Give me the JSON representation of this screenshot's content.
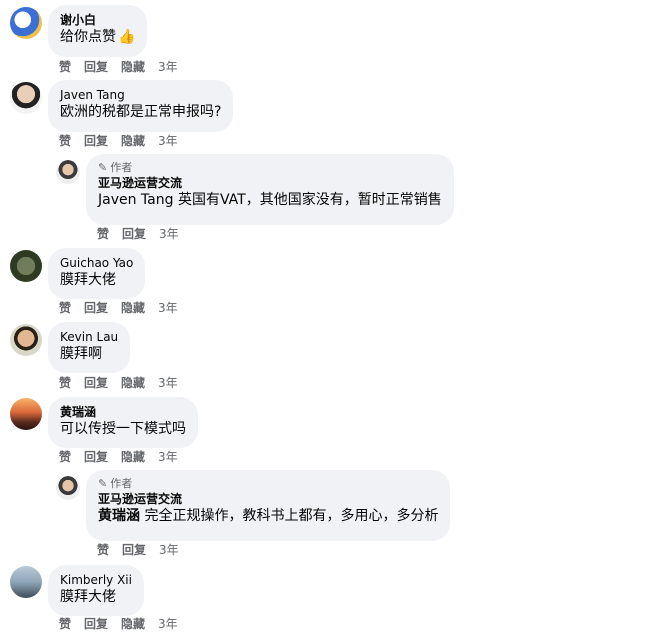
{
  "actions": {
    "like": "赞",
    "reply": "回复",
    "hide": "隐藏"
  },
  "comments": [
    {
      "name": "谢小白",
      "text": "给你点赞",
      "emoji": "👍",
      "time": "3年"
    },
    {
      "name": "Javen Tang",
      "text": "欧洲的税都是正常申报吗?",
      "time": "3年",
      "reply": {
        "tag": "作者",
        "name": "亚马逊运营交流",
        "mention": "Javen Tang",
        "text": " 英国有VAT，其他国家没有，暂时正常销售",
        "time": "3年"
      }
    },
    {
      "name": "Guichao Yao",
      "text": "膜拜大佬",
      "time": "3年"
    },
    {
      "name": "Kevin Lau",
      "text": "膜拜啊",
      "time": "3年"
    },
    {
      "name": "黄瑞涵",
      "text": "可以传授一下模式吗",
      "time": "3年",
      "reply": {
        "tag": "作者",
        "name": "亚马逊运营交流",
        "mention": "黄瑞涵",
        "text": " 完全正规操作，教科书上都有，多用心，多分析",
        "time": "3年"
      }
    },
    {
      "name": "Kimberly Xii",
      "text": "膜拜大佬",
      "time": "3年"
    }
  ]
}
